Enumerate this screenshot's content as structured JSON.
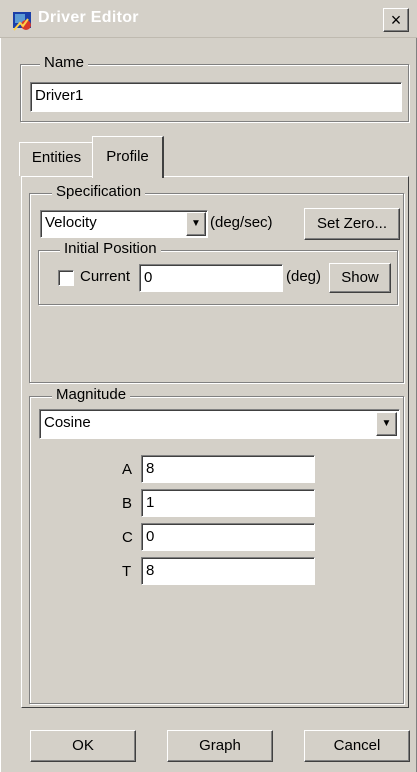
{
  "window": {
    "title": "Driver Editor",
    "close_glyph": "×",
    "icon": "driver-editor-icon"
  },
  "name_group": {
    "legend": "Name",
    "value": "Driver1"
  },
  "tabs": [
    {
      "label": "Entities"
    },
    {
      "label": "Profile"
    }
  ],
  "specification": {
    "legend": "Specification",
    "type_value": "Velocity",
    "units": "(deg/sec)",
    "set_zero_label": "Set Zero...",
    "initial_position": {
      "legend": "Initial Position",
      "current_label": "Current",
      "current_checked": false,
      "value": "0",
      "units": "(deg)",
      "show_label": "Show"
    }
  },
  "magnitude": {
    "legend": "Magnitude",
    "function_value": "Cosine",
    "params": [
      {
        "label": "A",
        "value": "8"
      },
      {
        "label": "B",
        "value": "1"
      },
      {
        "label": "C",
        "value": "0"
      },
      {
        "label": "T",
        "value": "8"
      }
    ]
  },
  "buttons": {
    "ok": "OK",
    "graph": "Graph",
    "cancel": "Cancel"
  },
  "dropdown_glyph": "▼"
}
